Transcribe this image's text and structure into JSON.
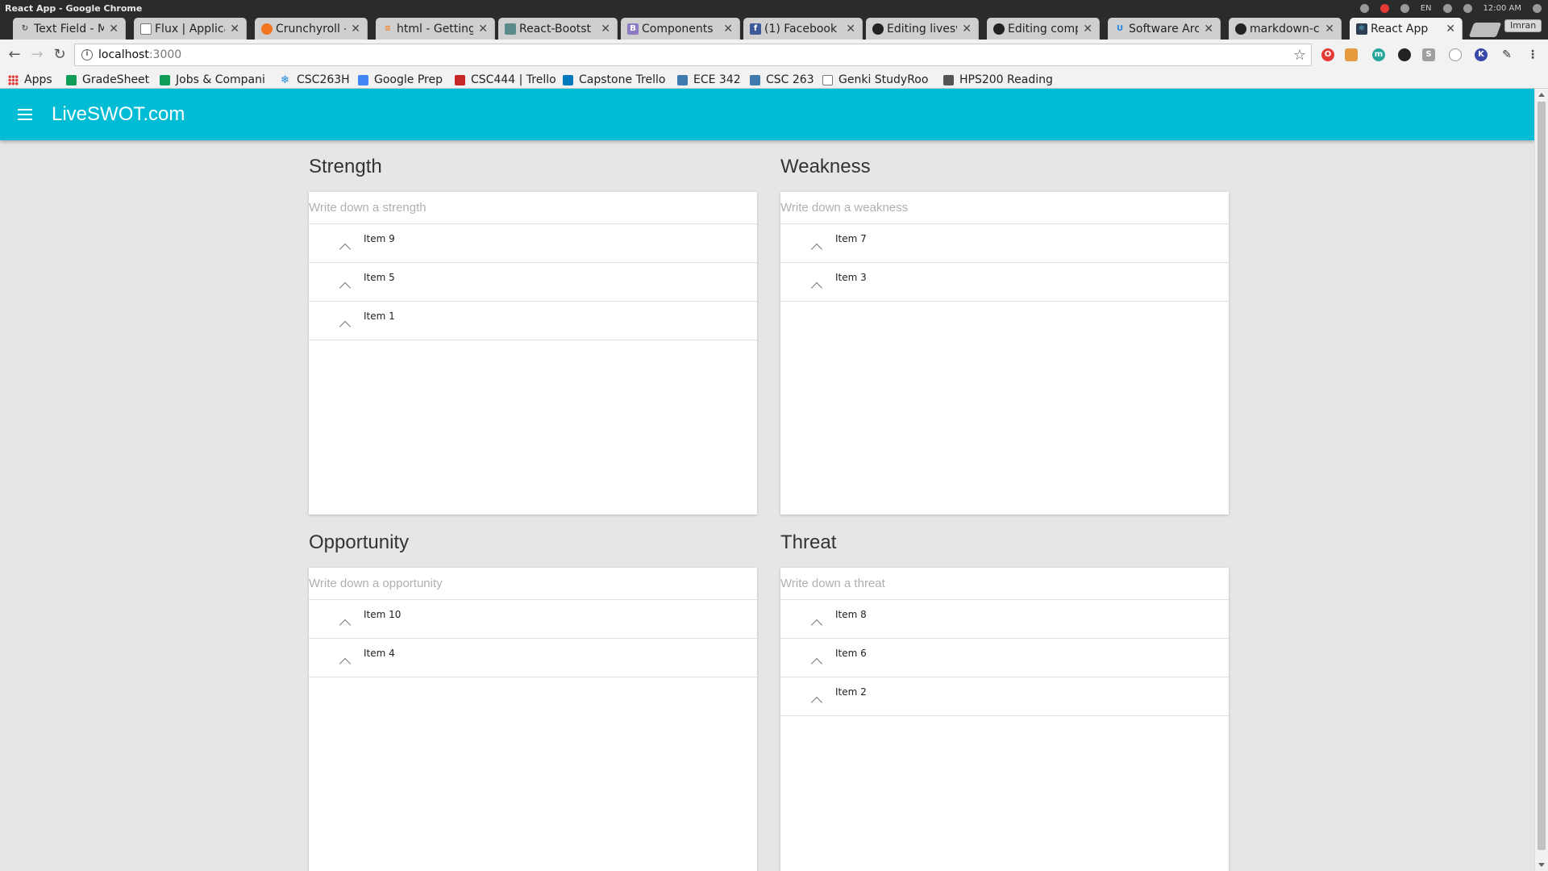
{
  "window": {
    "title": "React App - Google Chrome",
    "clock": "12:00 AM",
    "lang": "EN"
  },
  "tabs": [
    {
      "label": "Text Field - M",
      "favicon": "refresh-icon"
    },
    {
      "label": "Flux | Applica",
      "favicon": "page-icon"
    },
    {
      "label": "Crunchyroll -",
      "favicon": "crunchyroll-icon"
    },
    {
      "label": "html - Getting",
      "favicon": "stackoverflow-icon"
    },
    {
      "label": "React-Bootst",
      "favicon": "grid-icon"
    },
    {
      "label": "Components",
      "favicon": "bootstrap-icon"
    },
    {
      "label": "(1) Facebook",
      "favicon": "facebook-icon"
    },
    {
      "label": "Editing livesw",
      "favicon": "github-icon"
    },
    {
      "label": "Editing comp",
      "favicon": "github-icon"
    },
    {
      "label": "Software Arc",
      "favicon": "u-icon"
    },
    {
      "label": "markdown-ch",
      "favicon": "github-icon"
    },
    {
      "label": "React App",
      "favicon": "react-icon"
    }
  ],
  "profile": "Imran",
  "address_bar": {
    "host": "localhost",
    "port": ":3000"
  },
  "bookmarks": [
    {
      "label": "Apps",
      "icon": "apps-grid-icon"
    },
    {
      "label": "GradeSheet",
      "icon": "sheets-icon"
    },
    {
      "label": "Jobs & Compani",
      "icon": "sheets-icon"
    },
    {
      "label": "CSC263H",
      "icon": "snowflake-icon"
    },
    {
      "label": "Google Prep",
      "icon": "docs-icon"
    },
    {
      "label": "CSC444 | Trello",
      "icon": "red-square-icon"
    },
    {
      "label": "Capstone Trello",
      "icon": "trello-icon"
    },
    {
      "label": "ECE 342",
      "icon": "piazza-icon"
    },
    {
      "label": "CSC 263",
      "icon": "piazza-icon"
    },
    {
      "label": "Genki StudyRoo",
      "icon": "page-icon"
    },
    {
      "label": "HPS200 Reading",
      "icon": "folder-icon"
    }
  ],
  "appbar": {
    "title": "LiveSWOT.com"
  },
  "swot": {
    "strength": {
      "title": "Strength",
      "placeholder": "Write down a strength",
      "items": [
        "Item 9",
        "Item 5",
        "Item 1"
      ]
    },
    "weakness": {
      "title": "Weakness",
      "placeholder": "Write down a weakness",
      "items": [
        "Item 7",
        "Item 3"
      ]
    },
    "opportunity": {
      "title": "Opportunity",
      "placeholder": "Write down a opportunity",
      "items": [
        "Item 10",
        "Item 4"
      ]
    },
    "threat": {
      "title": "Threat",
      "placeholder": "Write down a threat",
      "items": [
        "Item 8",
        "Item 6",
        "Item 2"
      ]
    }
  },
  "colors": {
    "appbar": "#00bcd4",
    "background": "#e6e6e6",
    "card": "#ffffff"
  }
}
